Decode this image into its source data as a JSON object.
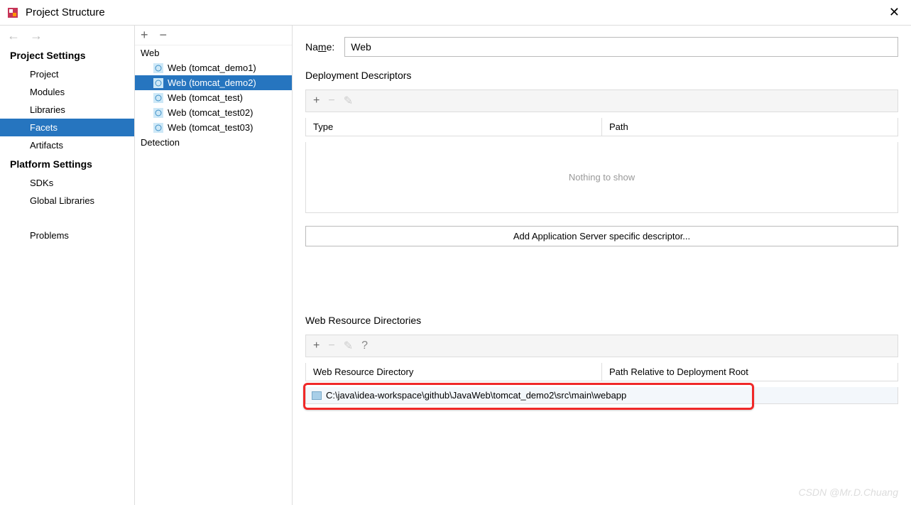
{
  "window": {
    "title": "Project Structure"
  },
  "leftNav": {
    "category1": "Project Settings",
    "items1": [
      "Project",
      "Modules",
      "Libraries",
      "Facets",
      "Artifacts"
    ],
    "selected1": "Facets",
    "category2": "Platform Settings",
    "items2": [
      "SDKs",
      "Global Libraries"
    ],
    "category3": "",
    "items3": [
      "Problems"
    ]
  },
  "middle": {
    "root": "Web",
    "children": [
      "Web (tomcat_demo1)",
      "Web (tomcat_demo2)",
      "Web (tomcat_test)",
      "Web (tomcat_test02)",
      "Web (tomcat_test03)"
    ],
    "selected": "Web (tomcat_demo2)",
    "detection": "Detection"
  },
  "right": {
    "nameLabelPre": "Na",
    "nameLabelMid": "m",
    "nameLabelPost": "e:",
    "nameValue": "Web",
    "depDescTitle": "Deployment Descriptors",
    "depColumns": [
      "Type",
      "Path"
    ],
    "depEmpty": "Nothing to show",
    "addDescBtnPre": "Add Application ",
    "addDescBtnMid": "S",
    "addDescBtnPost": "erver specific descriptor...",
    "wrdTitle": "Web Resource Directories",
    "wrdColumns": [
      "Web Resource Directory",
      "Path Relative to Deployment Root"
    ],
    "wrdPath": "C:\\java\\idea-workspace\\github\\JavaWeb\\tomcat_demo2\\src\\main\\webapp"
  },
  "watermark": "CSDN @Mr.D.Chuang"
}
